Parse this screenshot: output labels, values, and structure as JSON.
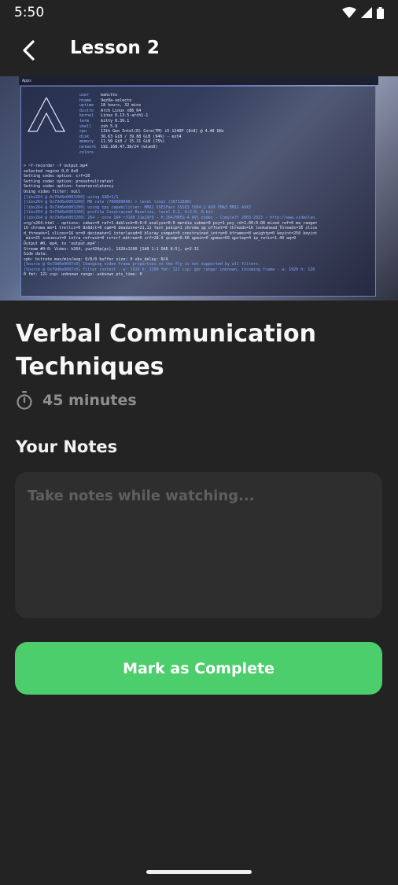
{
  "status_bar": {
    "time": "5:50"
  },
  "app_bar": {
    "title": "Lesson 2",
    "back_icon": "back-arrow-icon"
  },
  "video": {
    "topbar_apps": "Apps",
    "sysinfo_keys": [
      "user",
      "hname",
      "uptime",
      "distro",
      "kernel",
      "term",
      "shell",
      "cpu",
      "disk",
      "memory",
      "network",
      "colors"
    ],
    "sysinfo_vals": [
      "bahitto",
      "9ez9a-selecto",
      "18 hours, 32 mins",
      "Arch Linux x86_64",
      "Linux 6.13.5-arch1-1",
      "kitty 0.39.1",
      "zsh 5.9",
      "13th Gen Intel(R) Core(TM) i5-1240P (8+8) @ 4.40 GHz",
      "36.63 GiB / 39.88 GiB (94%) - ext4",
      "11.50 GiB / 15.31 GiB (75%)",
      "192.168.47.38/24 (wlan0)"
    ],
    "terminal_lines": [
      "> ~f-recorder -f output.mp4",
      "selected region 0,0 0x0",
      "Setting codec option: crf=28",
      "Setting codec option: preset=ultrafast",
      "Setting codec option: tune=zerolatency",
      "Using video filter: null",
      "[libx264 @ 0x79d6e0003200] using SAR=1/1",
      "[libx264 @ 0x79d6e0003200] MB rate (700000000) > level limit (16711680)",
      "[libx264 @ 0x79d6e0003200] using cpu capabilities: MMX2 SSE2Fast SSSE3 SSE4.2 AVX FMA3 BMI2 AVX2",
      "[libx264 @ 0x79d6e0003200] profile Constrained Baseline, level 6.2, 4:2:0, 8-bit",
      "[libx264 @ 0x79d6e0003200] 264 - core 164 r3108 31e19f9 - H.264/MPEG-4 AVC codec - Copyleft 2003-2023 - http://www.videolan.",
      "org/x264.html - options: cabac=0 ref=1 deblock=0:0:0 analyse=0:0 me=dia subme=0 psy=1 psy_rd=1.00:0.00 mixed_ref=0 me_range=",
      "16 chroma_me=1 trellis=0 8x8dct=0 cqm=0 deadzone=21,11 fast_pskip=1 chroma_qp_offset=0 threads=16 lookahead_threads=16 slice",
      "d_threads=1 slices=16 nr=0 decimate=1 interlaced=0 bluray_compat=0 constrained_intra=0 bframes=0 weightp=0 keyint=250 keyint",
      "_min=25 scenecut=0 intra_refresh=0 rc=crf mbtree=0 crf=28.0 qcomp=0.60 qpmin=0 qpmax=69 qpstep=4 ip_ratio=1.40 aq=0",
      "Output #0, mp4, to 'output.mp4':",
      "  Stream #0:0: Video: h264, yuv420p(pc), 1920x1200 [SAR 1:1 DAR 8:5], q=2-31",
      "      Side data:",
      "        cpb: bitrate max/min/avg: 0/0/0 buffer size: 0 vbv_delay: N/A",
      "[Source @ 0x79d6e0007c0] Changing video frame properties on the fly is not supported by all filters.",
      "[Source @ 0x79d6e0007c0] filter context - w: 1920 h: 1200 fmt: 121 csp: gbr range: unknown, incoming frame - w: 1920 h: 120",
      "0 fmt: 121 csp: unknown range: unknown pts_time: 0"
    ]
  },
  "lesson": {
    "title": "Verbal Communication Techniques",
    "duration": "45 minutes",
    "duration_icon": "stopwatch-icon"
  },
  "notes": {
    "label": "Your Notes",
    "placeholder": "Take notes while watching...",
    "value": ""
  },
  "actions": {
    "complete_label": "Mark as Complete"
  },
  "colors": {
    "background": "#232323",
    "accent": "#4cce6c",
    "input_bg": "#2e2e2e",
    "muted": "#8e8e8e"
  }
}
